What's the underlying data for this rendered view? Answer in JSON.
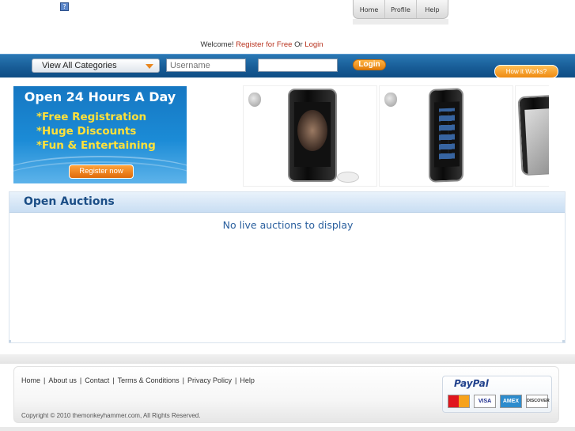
{
  "header": {
    "broken_image_glyph": "?",
    "nav": [
      {
        "label": "Home"
      },
      {
        "label": "Profile"
      },
      {
        "label": "Help"
      }
    ],
    "welcome": {
      "prefix": "Welcome!",
      "register_link": "Register for Free",
      "middle": "Or",
      "login_link": "Login"
    }
  },
  "search_bar": {
    "category_select": "View All Categories",
    "username_placeholder": "Username",
    "password_placeholder": "",
    "login_button": "Login",
    "how_it_works_button": "How it Works?"
  },
  "promo": {
    "headline": "Open 24 Hours A Day",
    "features": [
      "*Free Registration",
      "*Huge Discounts",
      "*Fun & Entertaining"
    ],
    "register_button": "Register now"
  },
  "auctions": {
    "title": "Open Auctions",
    "empty_message": "No live auctions to display"
  },
  "footer": {
    "links": [
      "Home",
      "About us",
      "Contact",
      "Terms & Conditions",
      "Privacy Policy",
      "Help"
    ],
    "copyright": "Copyright © 2010 themonkeyhammer.com, All Rights Reserved.",
    "payment_logo": "PayPal",
    "cards": [
      "MasterCard",
      "VISA",
      "AMEX",
      "DISCOVER"
    ]
  },
  "colors": {
    "bar_blue": "#185d97",
    "accent_orange": "#ee8a12",
    "auction_title": "#1b4e86",
    "link_red": "#b8321e"
  }
}
